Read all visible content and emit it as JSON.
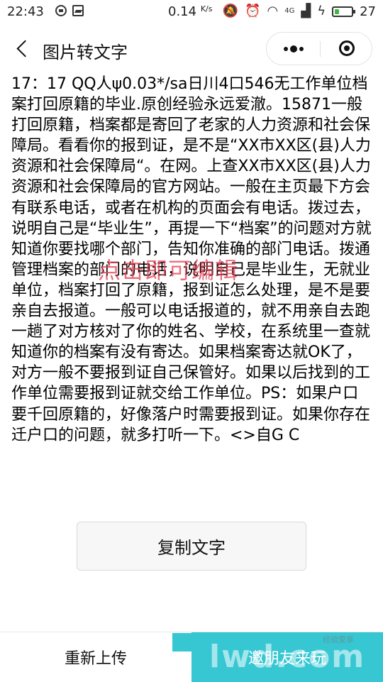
{
  "status_bar": {
    "time": "22:43",
    "net_speed": "0.14",
    "net_unit": "K/s",
    "network": "4G",
    "battery_level": "27",
    "battery_fraction": 0.27
  },
  "nav": {
    "title": "图片转文字"
  },
  "content": {
    "text": "17：17 QQ人ψ0.03*/sa日川4口546无工作单位档案打回原籍的毕业.原创经验永远爱澈。15871一般打回原籍，档案都是寄回了老家的人力资源和社会保障局。看看你的报到证，是不是“XX市XX区(县)人力资源和社会保障局“。在网。上查XX市XX区(县)人力资源和社会保障局的官方网站。一般在主页最下方会有联系电话，或者在机构的页面会有电话。拨过去，说明自己是“毕业生”，再提一下“档案”的问题对方就知道你要找哪个部门，告知你准确的部门电话。拨通管理档案的部门的电话，说明自己是毕业生，无就业单位，档案打回了原籍，报到证怎么处理，是不是要亲自去报道。一般可以电话报道的，就不用亲自去跑一趟了对方核对了你的姓名、学校，在系统里一查就知道你的档案有没有寄达。如果档案寄达就OK了，对方一般不要报到证自己保管好。如果以后找到的工作单位需要报到证就交给工作单位。PS：如果户口要千回原籍的，好像落户时需要报到证。如果你存在迁户口的问题，就多打听一下。<>自G C",
    "edit_hint": "点击即可编辑"
  },
  "copy_button": {
    "label": "复制文字"
  },
  "bottom_bar": {
    "reupload_label": "重新上传",
    "invite_label": "邀朋友来玩",
    "watermark_logo": "lwd.com",
    "watermark_small": "经验爱享"
  },
  "colors": {
    "accent": "#36c7d3",
    "battery": "#3cba3c",
    "edit_hint": "#e63c50"
  }
}
